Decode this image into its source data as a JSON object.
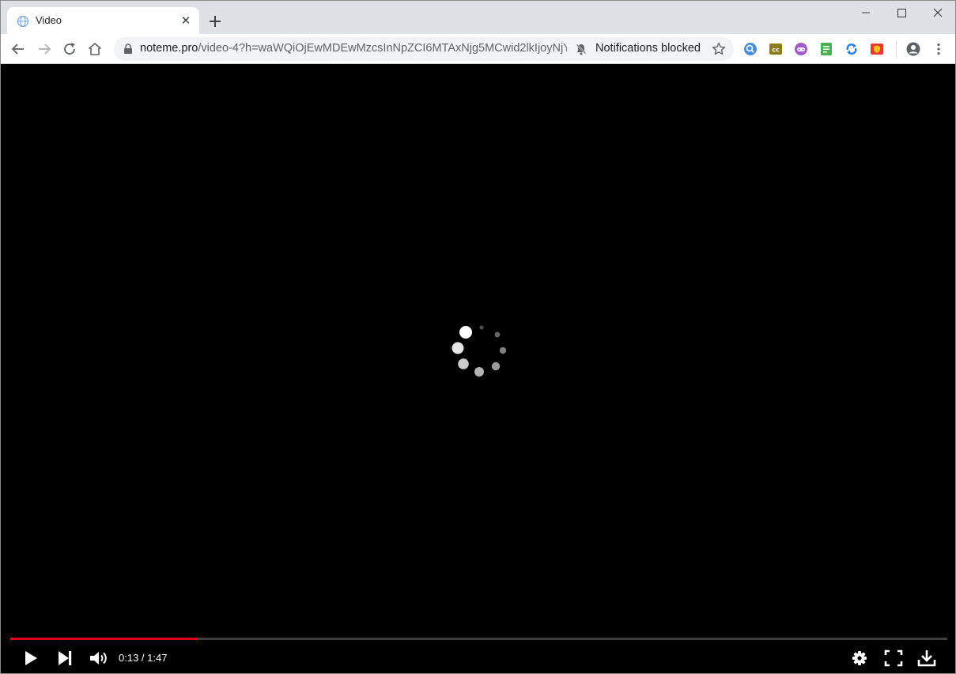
{
  "tab": {
    "title": "Video",
    "close_glyph": "✕"
  },
  "address_bar": {
    "host": "noteme.pro",
    "path": "/video-4?h=waWQiOjEwMDEwMzcsInNpZCI6MTAxNjg5MCwid2lkIjoyNjY...",
    "notification_text": "Notifications blocked"
  },
  "extensions": [
    {
      "icon": "blue-search-extension-icon",
      "color": "#4a8fd6"
    },
    {
      "icon": "cc-extension-icon",
      "color": "#8a7a1a"
    },
    {
      "icon": "gamepad-extension-icon",
      "color": "#a259c9"
    },
    {
      "icon": "green-doc-extension-icon",
      "color": "#4caf50"
    },
    {
      "icon": "sync-extension-icon",
      "color": "#2a7de1"
    },
    {
      "icon": "red-shield-extension-icon",
      "color": "#e53935"
    }
  ],
  "player": {
    "current_time": "0:13",
    "duration": "1:47",
    "time_display": "0:13 / 1:47",
    "progress_fraction": 0.2,
    "accent_color": "#e0001b"
  }
}
